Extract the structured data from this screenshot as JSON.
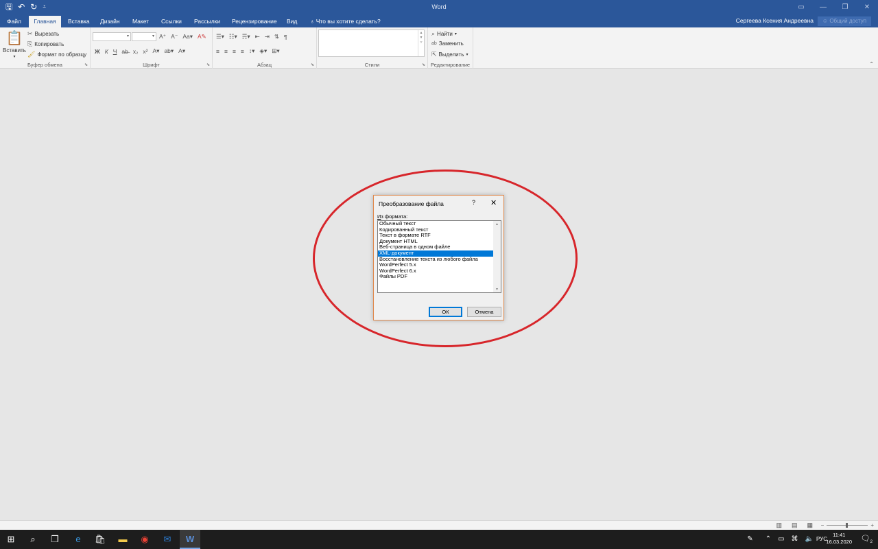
{
  "window": {
    "title": "Word",
    "qat": {
      "save_icon": "save-icon",
      "undo_icon": "undo-icon",
      "redo_icon": "redo-icon",
      "customize_icon": "customize-qat-icon"
    }
  },
  "tabs": [
    {
      "label": "Файл"
    },
    {
      "label": "Главная"
    },
    {
      "label": "Вставка"
    },
    {
      "label": "Дизайн"
    },
    {
      "label": "Макет"
    },
    {
      "label": "Ссылки"
    },
    {
      "label": "Рассылки"
    },
    {
      "label": "Рецензирование"
    },
    {
      "label": "Вид"
    }
  ],
  "tell_me": "Что вы хотите сделать?",
  "user_name": "Сергеева Ксения Андреевна",
  "share_label": "Общий доступ",
  "ribbon": {
    "clipboard": {
      "paste": "Вставить",
      "cut": "Вырезать",
      "copy": "Копировать",
      "format_painter": "Формат по образцу",
      "label": "Буфер обмена"
    },
    "font": {
      "label": "Шрифт",
      "bold": "Ж",
      "italic": "К",
      "underline": "Ч"
    },
    "paragraph": {
      "label": "Абзац"
    },
    "styles": {
      "label": "Стили"
    },
    "editing": {
      "find": "Найти",
      "replace": "Заменить",
      "select": "Выделить",
      "label": "Редактирование"
    }
  },
  "dialog": {
    "title": "Преобразование файла",
    "help": "?",
    "close": "✕",
    "from_format_label": "Из формата:",
    "formats": [
      "Обычный текст",
      "Кодированный текст",
      "Текст в формате RTF",
      "Документ HTML",
      "Веб-страница в одном файле",
      "XML-документ",
      "Восстановление текста из любого файла",
      "WordPerfect 5.x",
      "WordPerfect 6.x",
      "Файлы PDF"
    ],
    "selected_index": 5,
    "ok": "ОК",
    "cancel": "Отмена"
  },
  "taskbar": {
    "lang": "РУС",
    "time": "11:41",
    "date": "16.03.2020",
    "notifications": "2"
  },
  "colors": {
    "title_bar": "#2b579a",
    "highlight_ellipse": "#d7262b",
    "selection": "#0078d7"
  }
}
